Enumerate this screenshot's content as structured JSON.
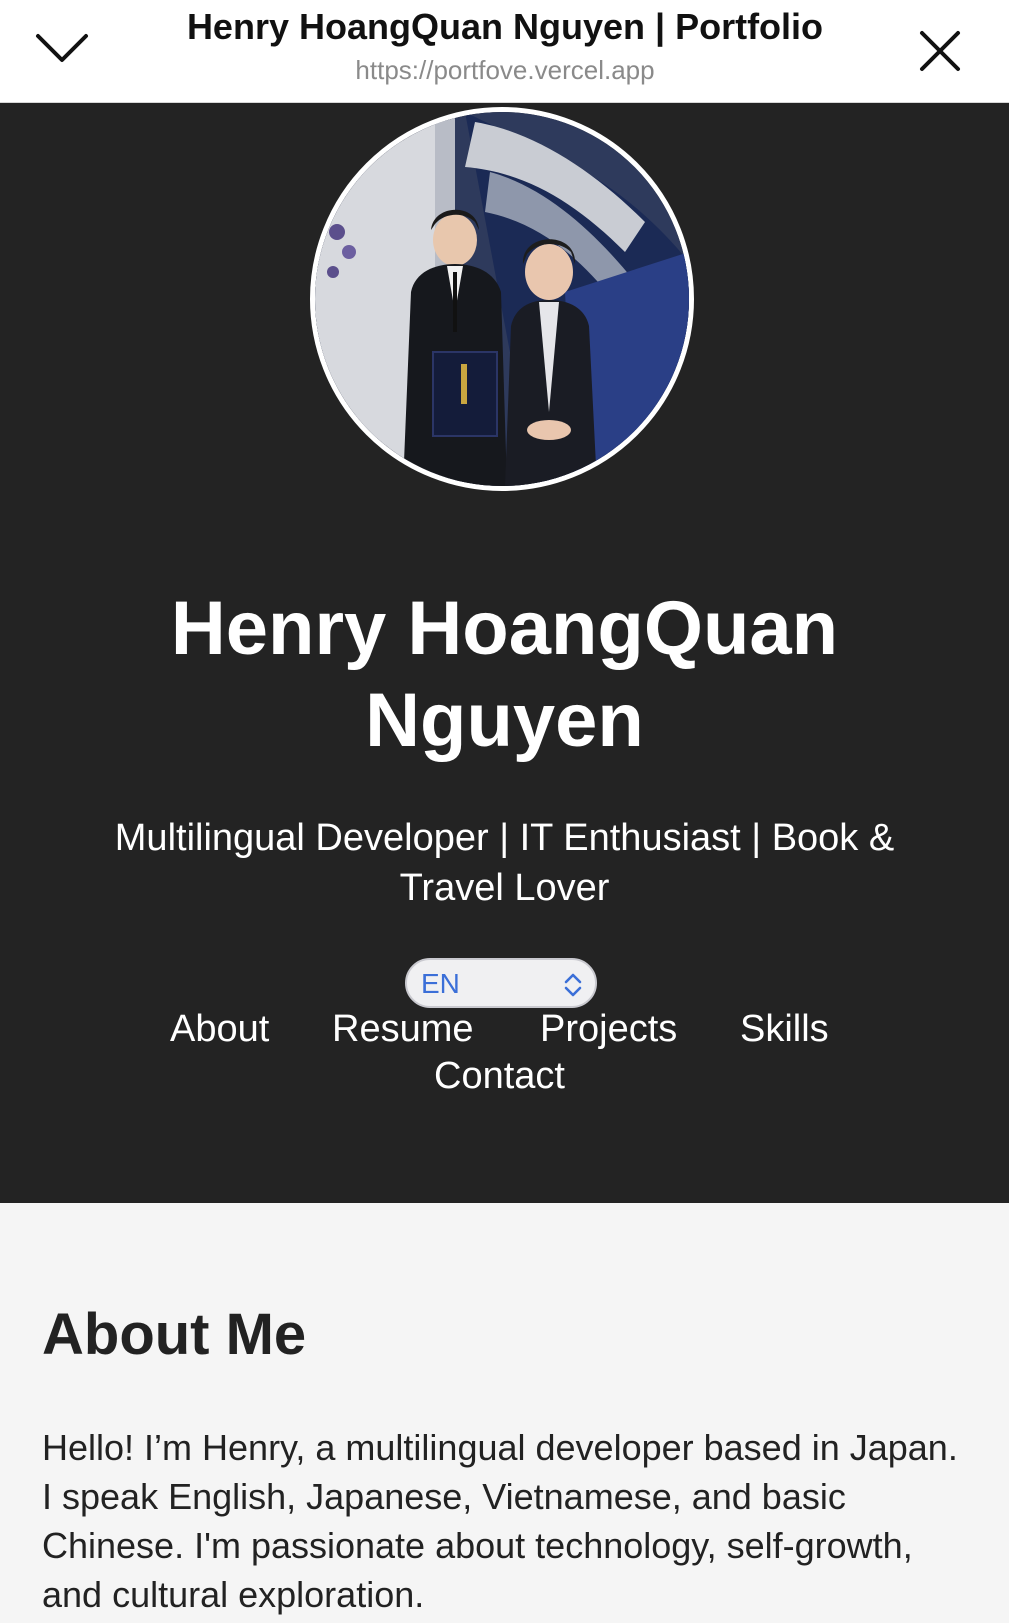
{
  "browser": {
    "title": "Henry HoangQuan Nguyen | Portfolio",
    "url": "https://portfove.vercel.app",
    "minimize_icon": "chevron-down-icon",
    "close_icon": "close-icon"
  },
  "hero": {
    "name": "Henry HoangQuan Nguyen",
    "tagline": "Multilingual Developer | IT Enthusiast | Book & Travel Lover",
    "language_selected": "EN",
    "nav": [
      "About",
      "Resume",
      "Projects",
      "Skills",
      "Contact"
    ]
  },
  "about": {
    "heading": "About Me",
    "body": "Hello! I’m Henry, a multilingual developer based in Japan. I speak English, Japanese, Vietnamese, and basic Chinese. I'm passionate about technology, self-growth, and cultural exploration."
  },
  "colors": {
    "hero_bg": "#232323",
    "page_bg": "#f5f5f5",
    "select_text": "#3b6fd8"
  }
}
